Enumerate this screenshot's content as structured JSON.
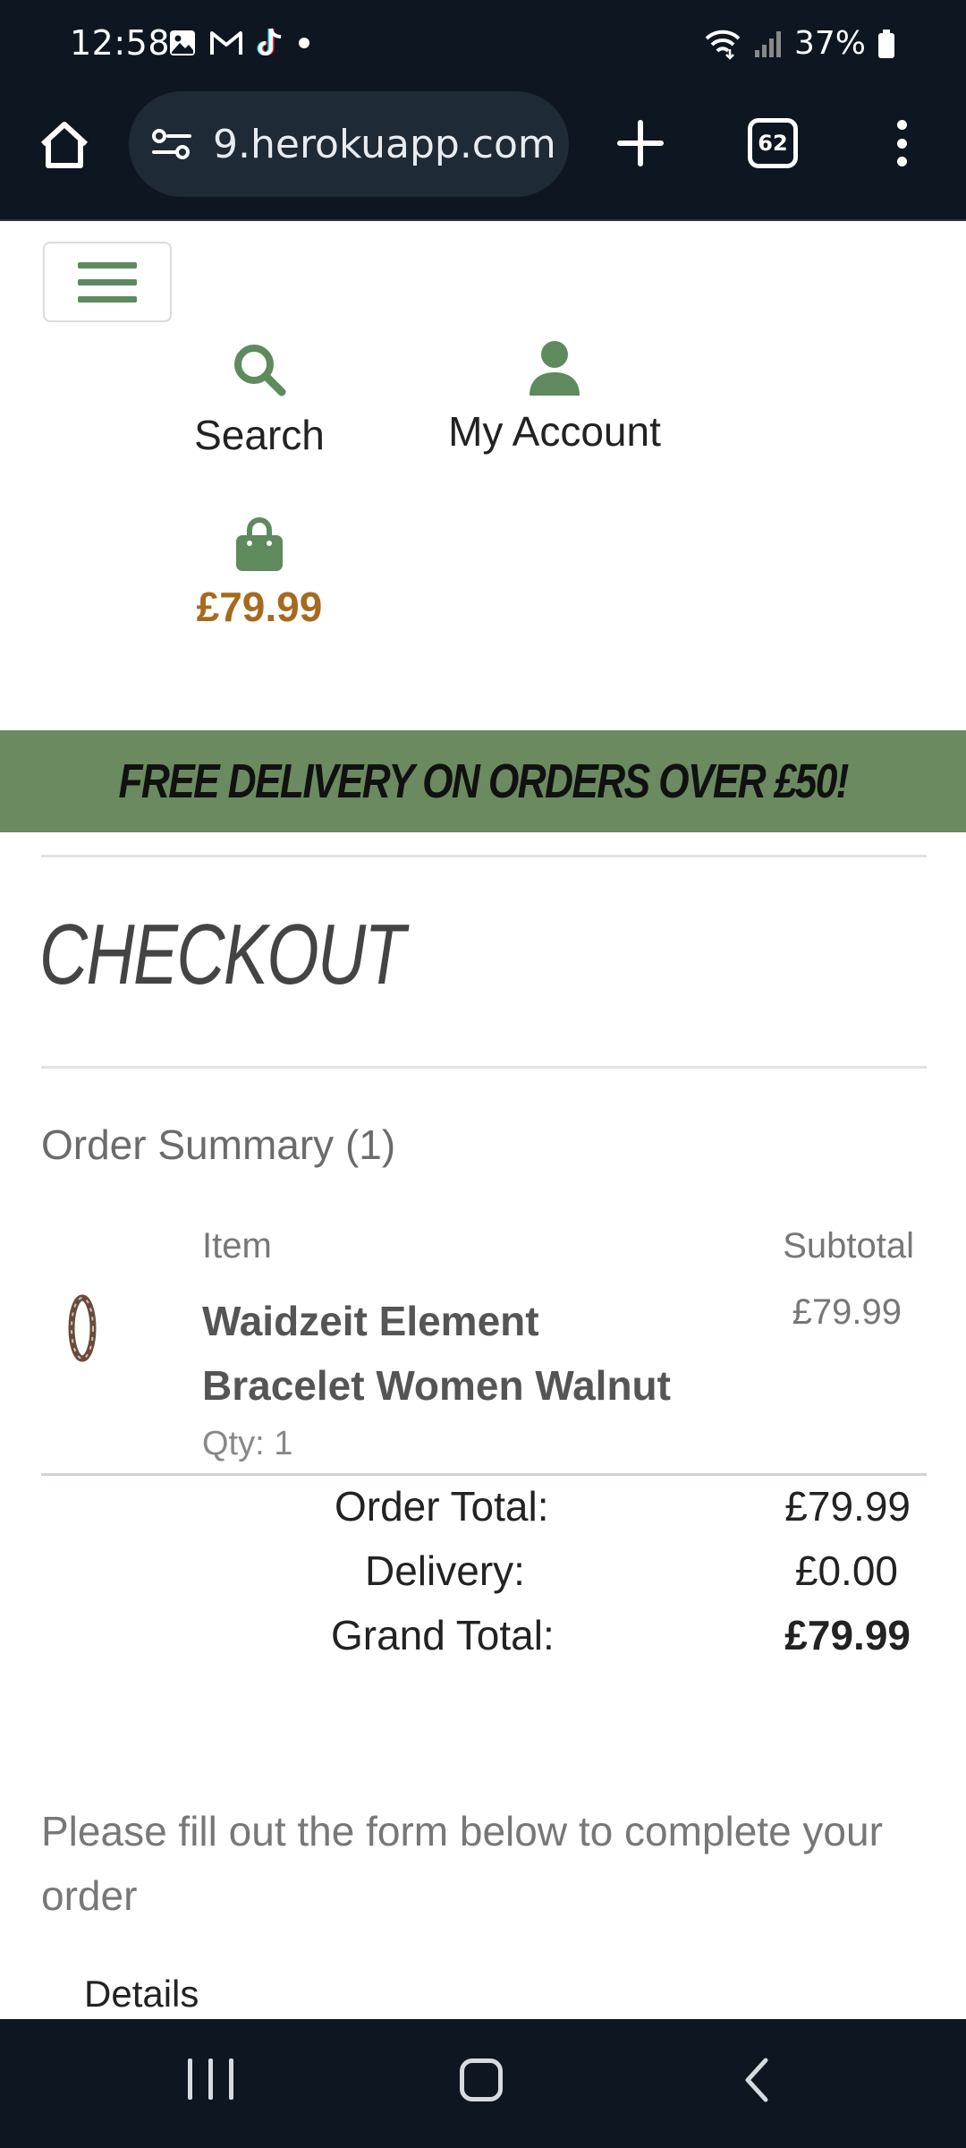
{
  "status_bar": {
    "time": "12:58",
    "battery": "37%",
    "icons_left": [
      "gallery-icon",
      "gmail-icon",
      "tiktok-icon",
      "dot-icon"
    ],
    "icons_right": [
      "wifi-icon",
      "signal-icon",
      "battery-icon"
    ]
  },
  "browser": {
    "url": "9.herokuapp.com",
    "tab_count": "62"
  },
  "header": {
    "search_label": "Search",
    "account_label": "My Account",
    "bag_total": "£79.99"
  },
  "banner": {
    "text": "FREE DELIVERY ON ORDERS OVER £50!"
  },
  "checkout": {
    "title": "CHECKOUT",
    "summary_heading": "Order Summary (1)",
    "columns": {
      "item": "Item",
      "subtotal": "Subtotal"
    },
    "product": {
      "name": "Waidzeit Element Bracelet Women Walnut",
      "price": "£79.99",
      "qty": "Qty: 1"
    },
    "totals": {
      "order_total_label": "Order Total:",
      "order_total_value": "£79.99",
      "delivery_label": "Delivery:",
      "delivery_value": "£0.00",
      "grand_total_label": "Grand Total:",
      "grand_total_value": "£79.99"
    },
    "form_note": "Please fill out the form below to complete your order",
    "details_label": "Details"
  },
  "colors": {
    "brand_green": "#6b8a60",
    "price_accent": "#a66a1e",
    "system_bar": "#0e1621"
  }
}
